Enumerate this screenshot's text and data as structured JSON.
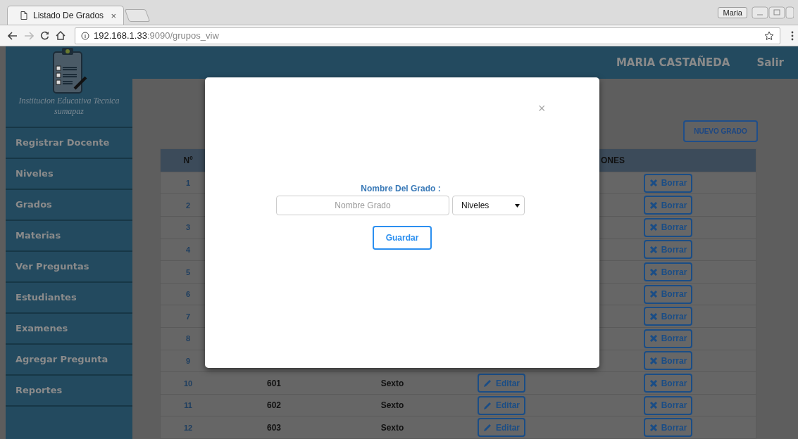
{
  "browser": {
    "tab_title": "Listado De Grados",
    "tab_close": "×",
    "profile": "Maria",
    "url_host": "192.168.1.33",
    "url_path": ":9090/grupos_viw"
  },
  "sidebar": {
    "school_name": "Institucion Educativa Tecnica sumapaz",
    "items": [
      {
        "label": "Registrar Docente"
      },
      {
        "label": "Niveles"
      },
      {
        "label": "Grados"
      },
      {
        "label": "Materias"
      },
      {
        "label": "Ver Preguntas"
      },
      {
        "label": "Estudiantes"
      },
      {
        "label": "Examenes"
      },
      {
        "label": "Agregar Pregunta"
      },
      {
        "label": "Reportes"
      }
    ]
  },
  "header": {
    "user": "MARIA CASTAÑEDA",
    "logout": "Salir"
  },
  "main": {
    "new_button": "NUEVO GRADO",
    "table": {
      "columns": [
        {
          "label": "Nº"
        },
        {
          "label": "ONES"
        }
      ],
      "rows": [
        {
          "number": "1",
          "delete": "Borrar"
        },
        {
          "number": "2",
          "delete": "Borrar"
        },
        {
          "number": "3",
          "delete": "Borrar"
        },
        {
          "number": "4",
          "delete": "Borrar"
        },
        {
          "number": "5",
          "delete": "Borrar"
        },
        {
          "number": "6",
          "delete": "Borrar"
        },
        {
          "number": "7",
          "delete": "Borrar"
        },
        {
          "number": "8",
          "delete": "Borrar"
        },
        {
          "number": "9",
          "delete": "Borrar"
        },
        {
          "number": "10",
          "code": "601",
          "name": "Sexto",
          "edit": "Editar",
          "delete": "Borrar"
        },
        {
          "number": "11",
          "code": "602",
          "name": "Sexto",
          "edit": "Editar",
          "delete": "Borrar"
        },
        {
          "number": "12",
          "code": "603",
          "name": "Sexto",
          "edit": "Editar",
          "delete": "Borrar"
        }
      ]
    }
  },
  "modal": {
    "close": "×",
    "label": "Nombre Del Grado :",
    "placeholder": "Nombre Grado",
    "select": "Niveles",
    "button": "Guardar"
  }
}
